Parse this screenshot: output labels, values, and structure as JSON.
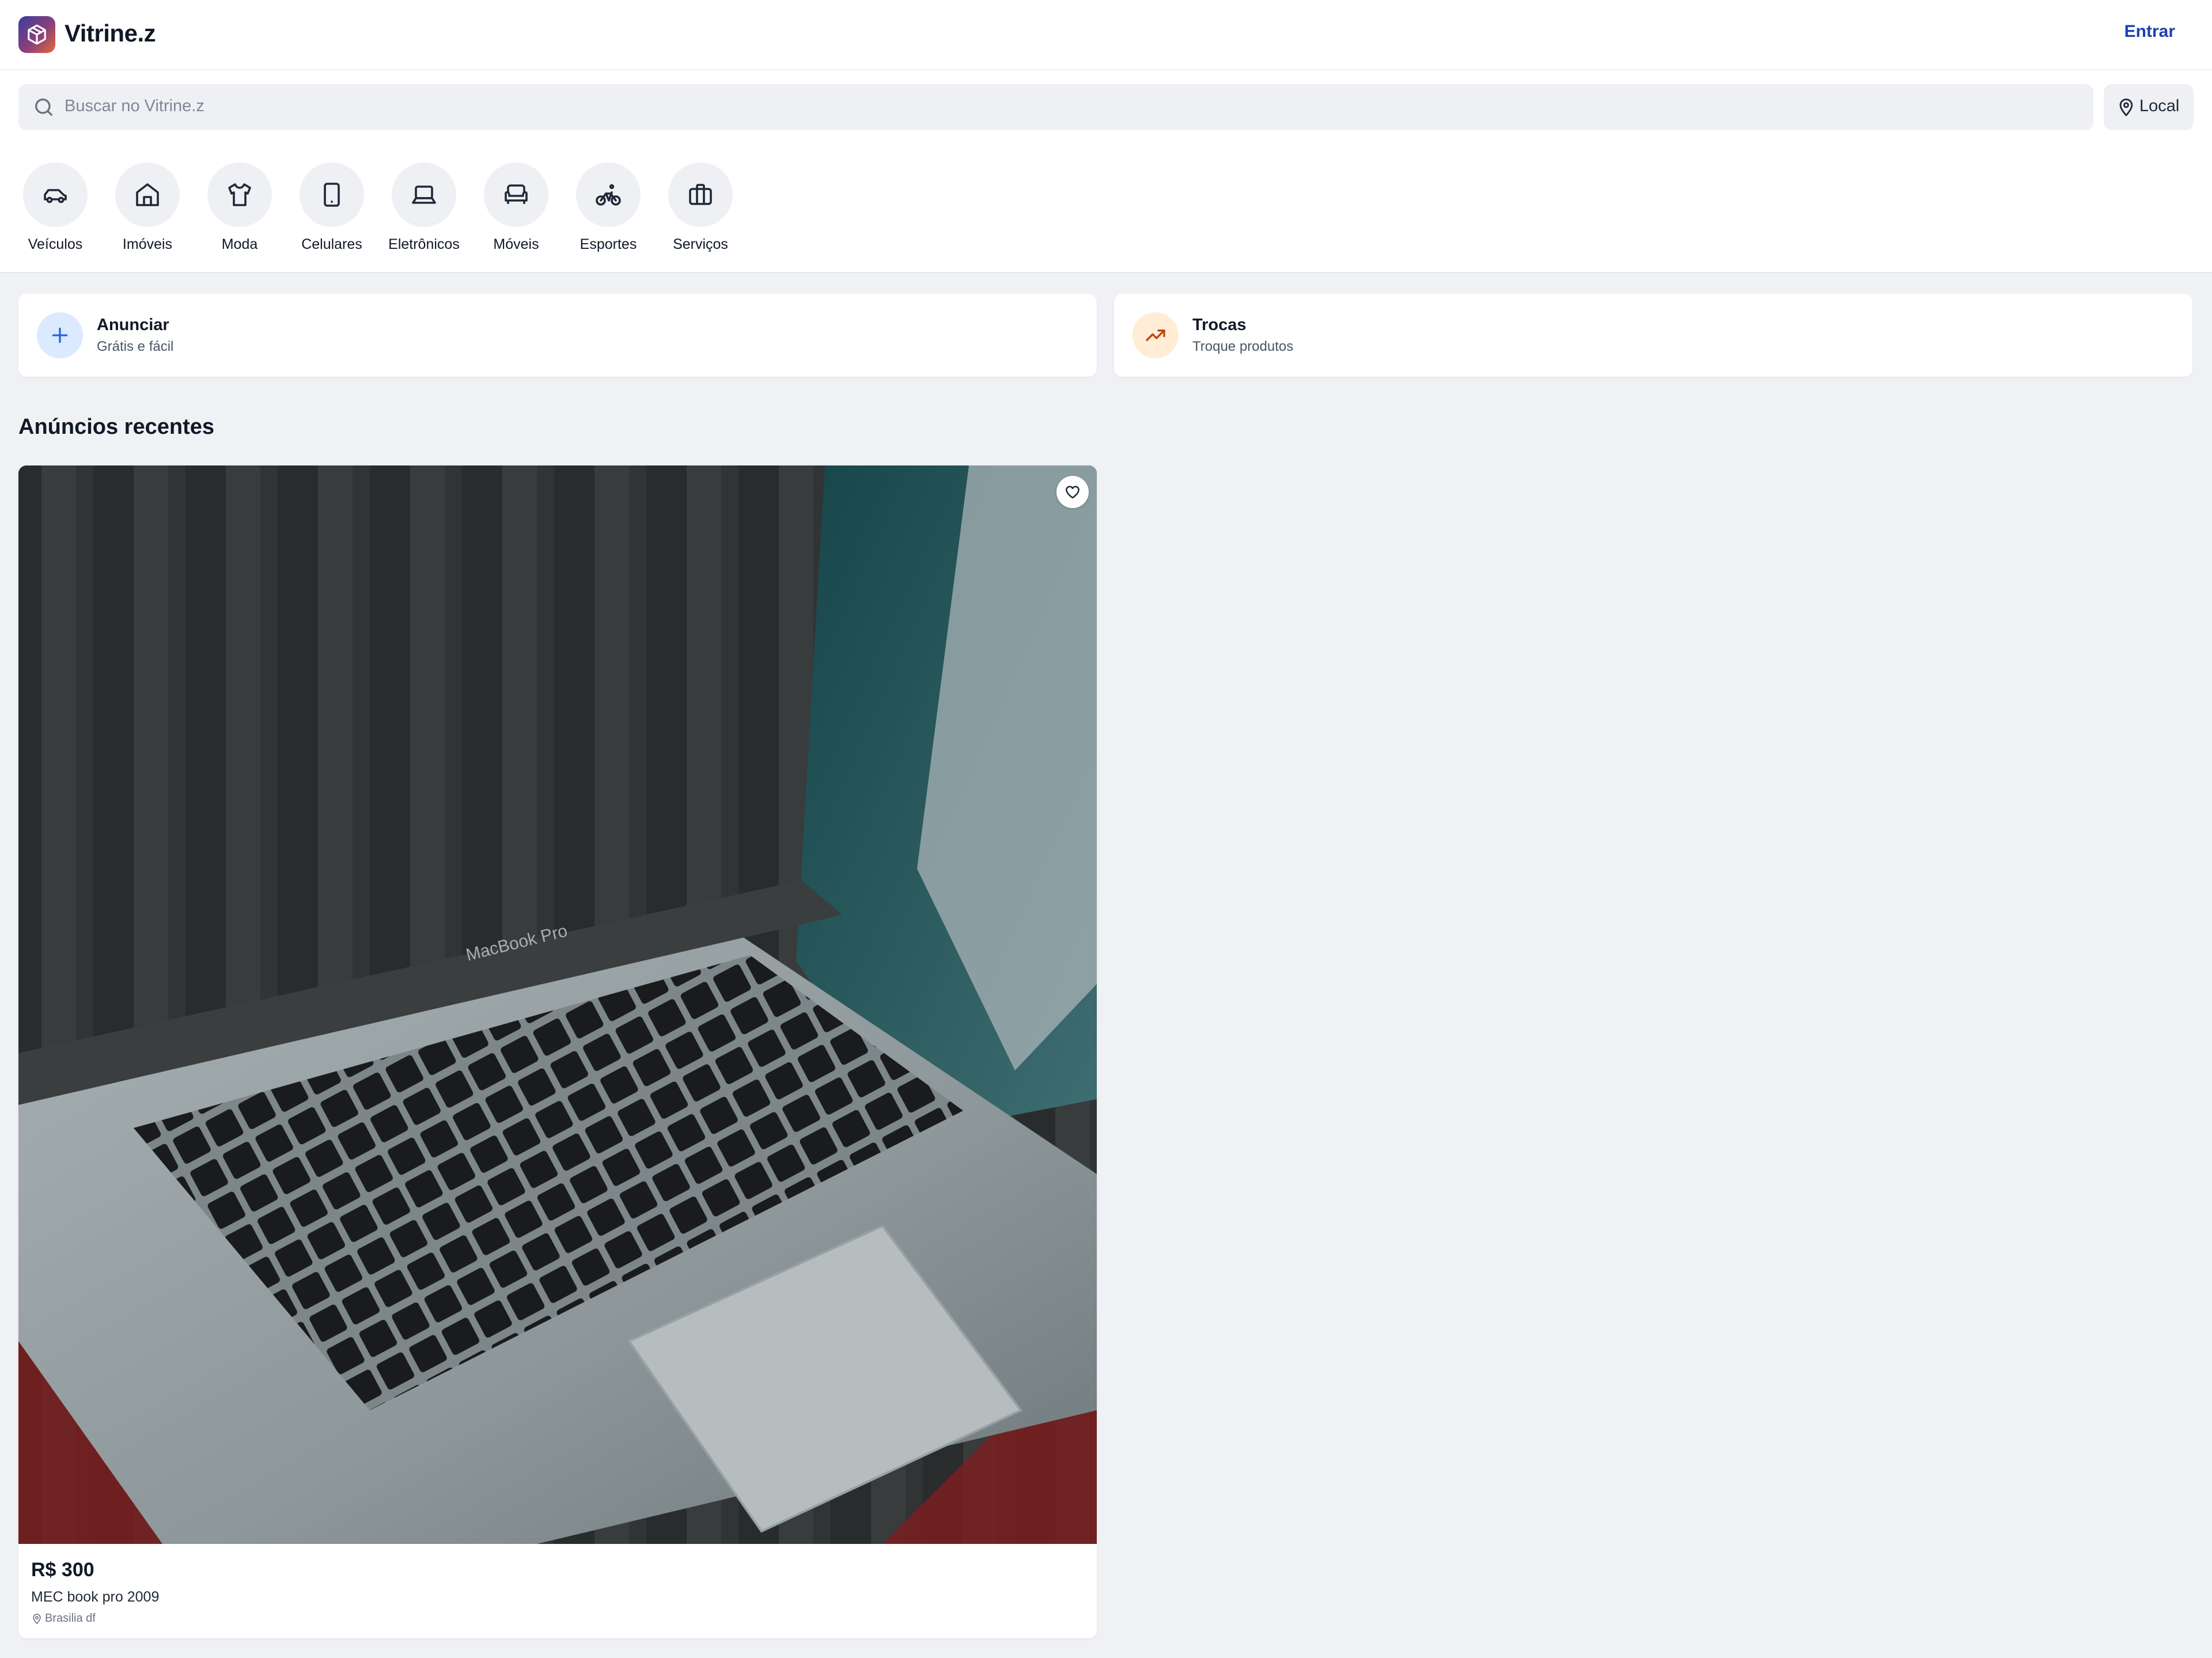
{
  "header": {
    "brand": "Vitrine.z",
    "logo_icon": "package-icon",
    "login_label": "Entrar",
    "login_color": "#1e40af"
  },
  "search": {
    "placeholder": "Buscar no Vitrine.z",
    "location_label": "Local"
  },
  "categories": [
    {
      "label": "Veículos",
      "icon": "car-icon"
    },
    {
      "label": "Imóveis",
      "icon": "house-icon"
    },
    {
      "label": "Moda",
      "icon": "shirt-icon"
    },
    {
      "label": "Celulares",
      "icon": "smartphone-icon"
    },
    {
      "label": "Eletrônicos",
      "icon": "laptop-icon"
    },
    {
      "label": "Móveis",
      "icon": "sofa-icon"
    },
    {
      "label": "Esportes",
      "icon": "bike-icon"
    },
    {
      "label": "Serviços",
      "icon": "briefcase-icon"
    }
  ],
  "actions": [
    {
      "title": "Anunciar",
      "subtitle": "Grátis e fácil",
      "icon": "plus-icon",
      "color": "#dbeafe"
    },
    {
      "title": "Trocas",
      "subtitle": "Troque produtos",
      "icon": "trending-up-icon",
      "color": "#ffedd5"
    }
  ],
  "recent": {
    "title": "Anúncios recentes",
    "listings": [
      {
        "price": "R$ 300",
        "title": "MEC book pro 2009",
        "location": "Brasilia df",
        "image": "laptop-photo",
        "image_label": "MacBook Pro"
      }
    ]
  }
}
